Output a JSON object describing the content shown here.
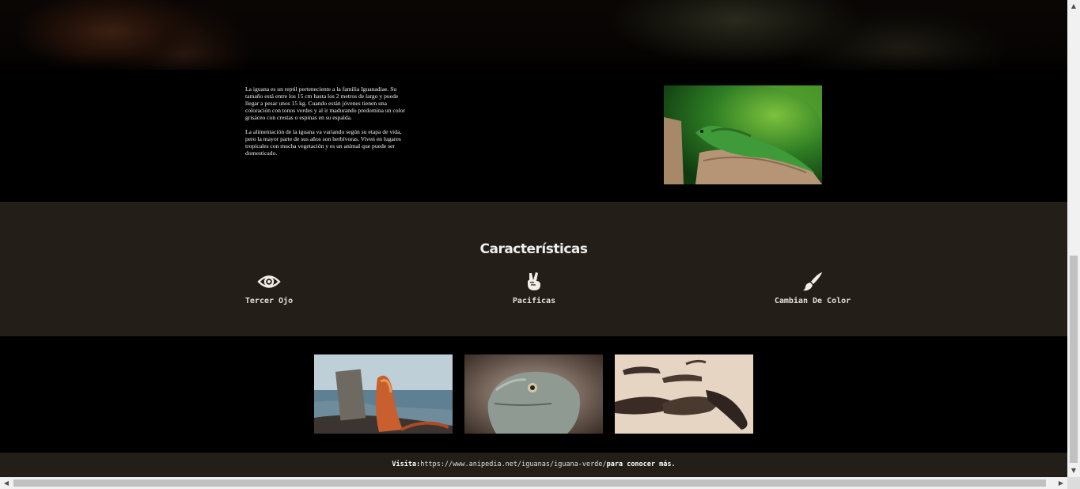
{
  "intro": {
    "paragraph_1": "La iguana es un reptil perteneciente a la familia Iguanadiae. Su tamaño está entre los 15 cm hasta los 2 metros de largo y puede llegar a pesar unos 15 kg. Cuando están jóvenes tienen una coloración con tonos verdes y al ir madurando predomina un color grisáceo con crestas o espinas en su espalda.",
    "paragraph_2": "La alimentación de la iguana va variando según su etapa de vida, pero la mayor parte de sus años son herbívoras. Viven en lugares tropicales con mucha vegetación y es un animal que puede ser domesticado."
  },
  "features": {
    "title": "Características",
    "items": [
      {
        "label": "Tercer Ojo",
        "icon": "eye-icon"
      },
      {
        "label": "Pacificas",
        "icon": "peace-hand-icon"
      },
      {
        "label": "Cambian De Color",
        "icon": "paint-brush-icon"
      }
    ]
  },
  "footer": {
    "prefix": "Visita:",
    "url": "https://www.anipedia.net/iguanas/iguana-verde/",
    "suffix": "para conocer más."
  },
  "colors": {
    "section_brown": "#231e18",
    "background": "#000000",
    "text_light": "#e6e0d6"
  }
}
